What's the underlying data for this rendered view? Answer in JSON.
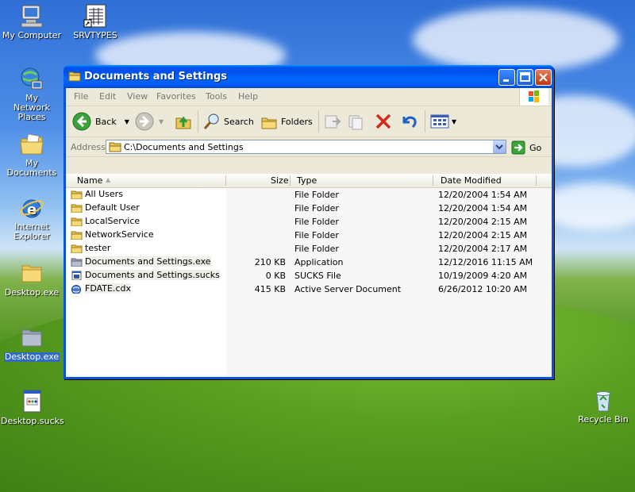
{
  "desktop": {
    "icons": [
      {
        "label": "My Computer"
      },
      {
        "label": "SRVTYPES"
      },
      {
        "label": "My Network Places"
      },
      {
        "label": "My Documents"
      },
      {
        "label": "Internet Explorer"
      },
      {
        "label": "Desktop.exe"
      },
      {
        "label": "Desktop.exe"
      },
      {
        "label": "Desktop.sucks"
      },
      {
        "label": "Recycle Bin"
      }
    ]
  },
  "window": {
    "title": "Documents and Settings",
    "menu": [
      "File",
      "Edit",
      "View",
      "Favorites",
      "Tools",
      "Help"
    ],
    "toolbar": {
      "back_label": "Back",
      "search_label": "Search",
      "folders_label": "Folders"
    },
    "address": {
      "label": "Address",
      "value": "C:\\Documents and Settings",
      "go_label": "Go"
    },
    "columns": {
      "name": "Name",
      "size": "Size",
      "type": "Type",
      "date": "Date Modified"
    },
    "files": [
      {
        "name": "All Users",
        "size": "",
        "type": "File Folder",
        "date": "12/20/2004 1:54 AM"
      },
      {
        "name": "Default User",
        "size": "",
        "type": "File Folder",
        "date": "12/20/2004 1:54 AM"
      },
      {
        "name": "LocalService",
        "size": "",
        "type": "File Folder",
        "date": "12/20/2004 2:15 AM"
      },
      {
        "name": "NetworkService",
        "size": "",
        "type": "File Folder",
        "date": "12/20/2004 2:15 AM"
      },
      {
        "name": "tester",
        "size": "",
        "type": "File Folder",
        "date": "12/20/2004 2:17 AM"
      },
      {
        "name": "Documents and Settings.exe",
        "size": "210 KB",
        "type": "Application",
        "date": "12/12/2016 11:15 AM"
      },
      {
        "name": "Documents and Settings.sucks",
        "size": "0 KB",
        "type": "SUCKS File",
        "date": "10/19/2009 4:20 AM"
      },
      {
        "name": "FDATE.cdx",
        "size": "415 KB",
        "type": "Active Server Document",
        "date": "6/26/2012 10:20 AM"
      }
    ]
  }
}
